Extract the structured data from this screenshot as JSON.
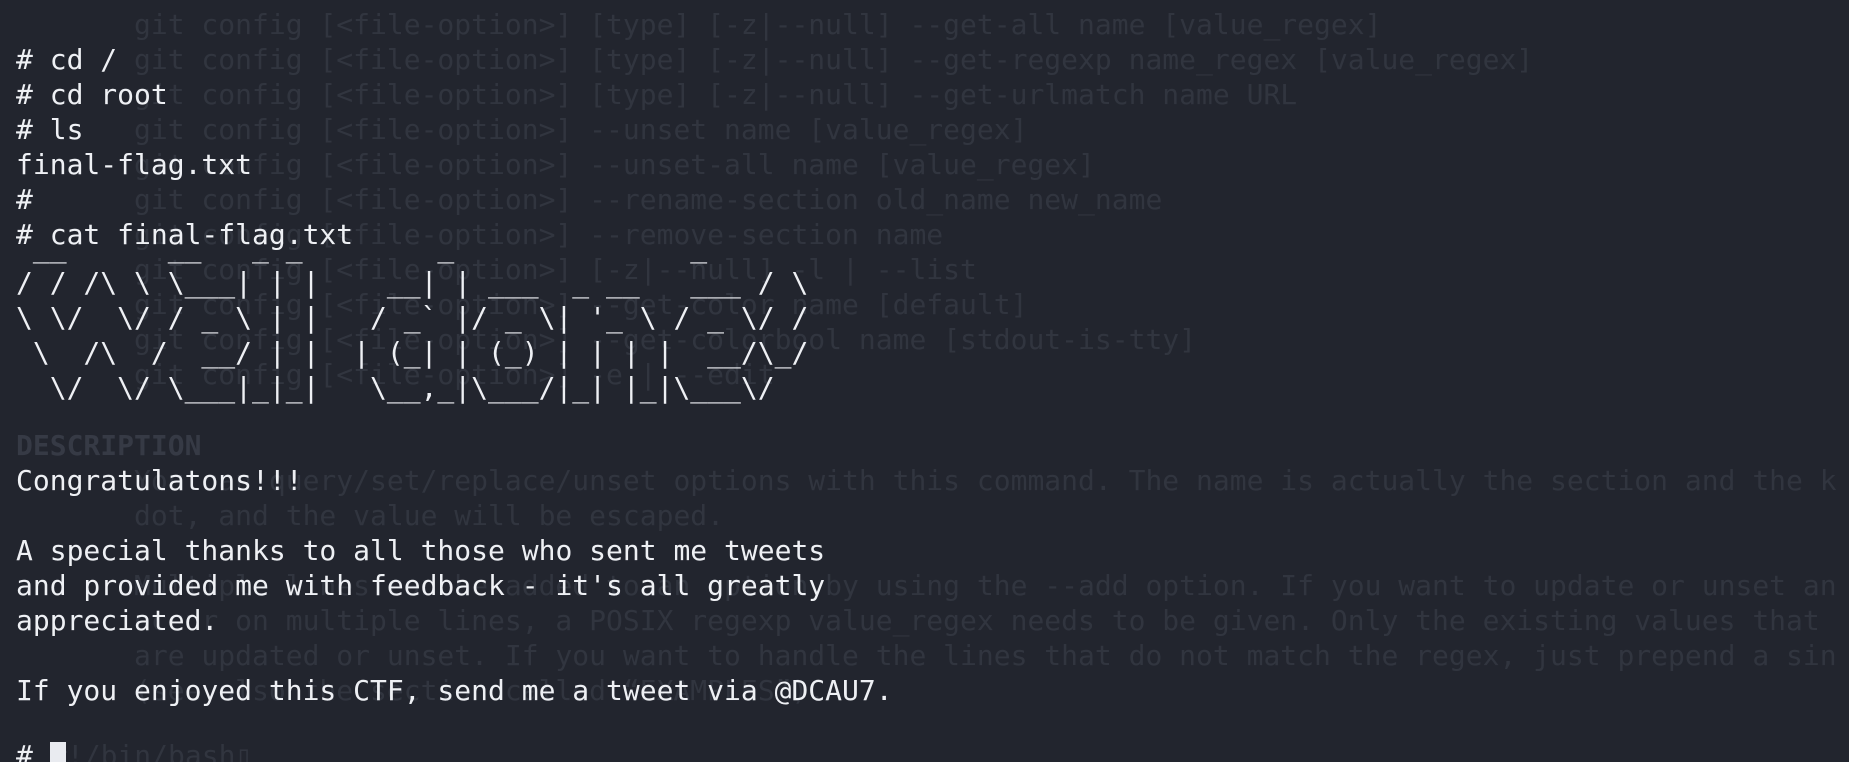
{
  "background_color": "#22252e",
  "text_color": "#eef0f4",
  "ghost_color": "#31353f",
  "background_man_page": {
    "lines": [
      "git config [<file-option>] [type] [-z|--null] --get-all name [value_regex]",
      "git config [<file-option>] [type] [-z|--null] --get-regexp name_regex [value_regex]",
      "git config [<file-option>] [type] [-z|--null] --get-urlmatch name URL",
      "git config [<file-option>] --unset name [value_regex]",
      "git config [<file-option>] --unset-all name [value_regex]",
      "git config [<file-option>] --rename-section old_name new_name",
      "git config [<file-option>] --remove-section name",
      "git config [<file-option>] [-z|--null] -l | --list",
      "git config [<file-option>] --get-color name [default]",
      "git config [<file-option>] --get-colorbool name [stdout-is-tty]",
      "git config [<file-option>] -e | --edit"
    ],
    "description_heading": "DESCRIPTION",
    "description_lines": [
      "You can query/set/replace/unset options with this command. The name is actually the section and the k",
      "dot, and the value will be escaped.",
      "Multiple lines can be added to an option by using the --add option. If you want to update or unset an",
      "occur on multiple lines, a POSIX regexp value_regex needs to be given. Only the existing values that",
      "are updated or unset. If you want to handle the lines that do not match the regex, just prepend a sin",
      "(see also the section called “EXAMPLES”)."
    ],
    "shell_line": "#!/bin/bash▯"
  },
  "terminal": {
    "lines": [
      "# cd /",
      "# cd root",
      "# ls",
      "final-flag.txt",
      "#",
      "# cat final-flag.txt"
    ],
    "ascii_art": " __      __   _ _        _              _\n/ / /\\ \\ \\___| | |    __| | ___  _ __   ___ / \\\n\\ \\/  \\/ / _ \\ | |   / _` |/ _ \\| '_ \\ / _ \\/ /\n \\  /\\  /  __/ | |  | (_| | (_) | | | |  __/\\_/\n  \\/  \\/ \\___|_|_|   \\__,_|\\___/|_| |_|\\___\\/",
    "congrats": "Congratulatons!!!",
    "thanks_lines": [
      "A special thanks to all those who sent me tweets",
      "and provided me with feedback - it's all greatly",
      "appreciated."
    ],
    "tweet_line": "If you enjoyed this CTF, send me a tweet via @DCAU7.",
    "prompt": "#"
  }
}
